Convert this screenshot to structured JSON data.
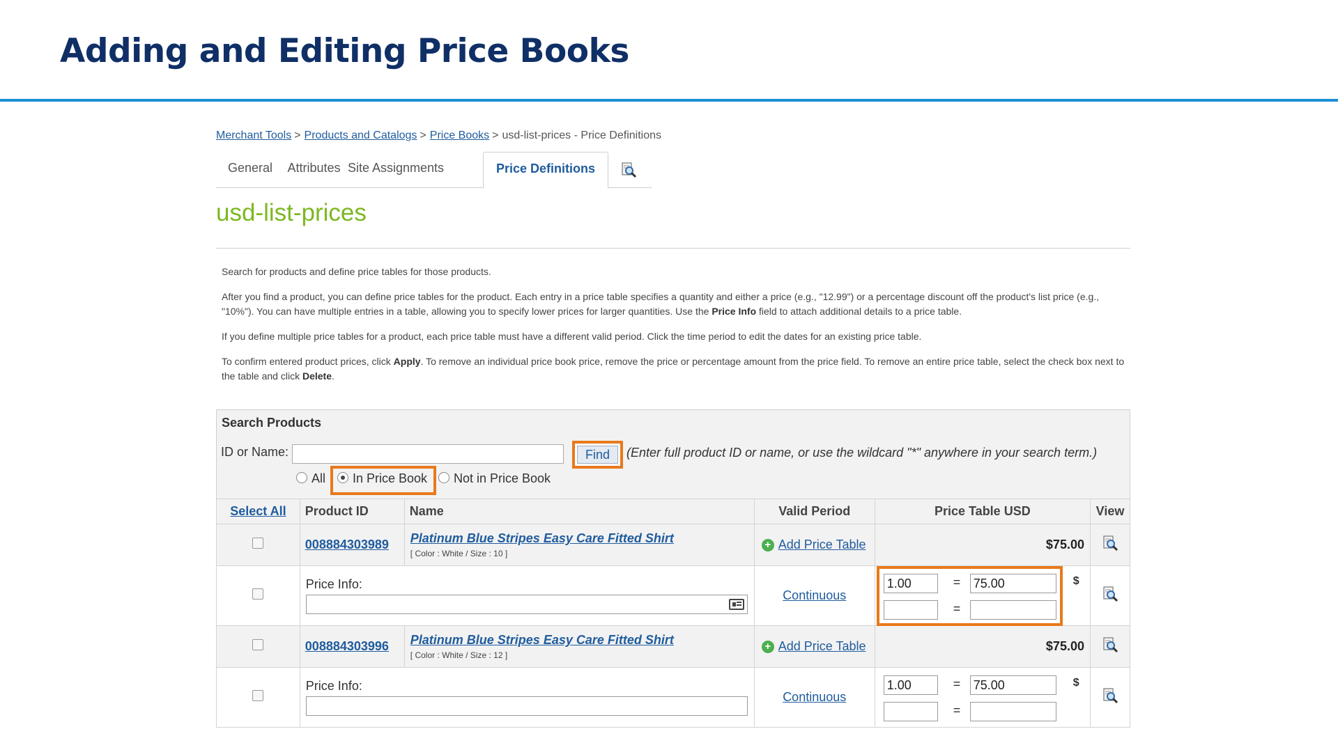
{
  "slide": {
    "title": "Adding and Editing Price Books"
  },
  "breadcrumb": {
    "items": [
      "Merchant Tools",
      "Products and Catalogs",
      "Price Books"
    ],
    "separator": ">",
    "current": "usd-list-prices - Price Definitions"
  },
  "tabs": [
    {
      "label": "General"
    },
    {
      "label": "Attributes"
    },
    {
      "label": "Site Assignments"
    },
    {
      "label": "Price Definitions",
      "active": true
    }
  ],
  "tab_extra_icon": "view-icon",
  "pricebook": {
    "name": "usd-list-prices"
  },
  "description": {
    "p1": "Search for products and define price tables for those products.",
    "p2a": "After you find a product, you can define price tables for the product. Each entry in a price table specifies a quantity and either a price (e.g., \"12.99\") or a percentage discount off the product's list price (e.g., \"10%\"). You can have multiple entries in a table, allowing you to specify lower prices for larger quantities. Use the ",
    "p2b": "Price Info",
    "p2c": " field to attach additional details to a price table.",
    "p3": "If you define multiple price tables for a product, each price table must have a different valid period. Click the time period to edit the dates for an existing price table.",
    "p4a": "To confirm entered product prices, click ",
    "p4b": "Apply",
    "p4c": ". To remove an individual price book price, remove the price or percentage amount from the price field. To remove an entire price table, select the check box next to the table and click ",
    "p4d": "Delete",
    "p4e": "."
  },
  "search": {
    "title": "Search Products",
    "id_label": "ID or Name:",
    "id_value": "",
    "find_label": "Find",
    "hint": "(Enter full product ID or name, or use the wildcard \"*\" anywhere in your search term.)",
    "filters": [
      {
        "label": "All",
        "selected": false
      },
      {
        "label": "In Price Book",
        "selected": true
      },
      {
        "label": "Not in Price Book",
        "selected": false
      }
    ]
  },
  "table": {
    "headers": {
      "select_all": "Select All",
      "product_id": "Product ID",
      "name": "Name",
      "valid_period": "Valid Period",
      "price_table": "Price Table USD",
      "view": "View"
    },
    "products": [
      {
        "id": "008884303989",
        "name": "Platinum Blue Stripes Easy Care Fitted Shirt",
        "attrs": "[ Color :  White / Size :  10 ]",
        "add_price_table": "Add Price Table",
        "price": "$75.00",
        "price_info_label": "Price Info:",
        "price_info_value": "",
        "valid_period": "Continuous",
        "entries": [
          {
            "quantity": "1.00",
            "price": "75.00"
          },
          {
            "quantity": "",
            "price": ""
          }
        ],
        "currency": "$"
      },
      {
        "id": "008884303996",
        "name": "Platinum Blue Stripes Easy Care Fitted Shirt",
        "attrs": "[ Color :  White / Size :  12 ]",
        "add_price_table": "Add Price Table",
        "price": "$75.00",
        "price_info_label": "Price Info:",
        "price_info_value": "",
        "valid_period": "Continuous",
        "entries": [
          {
            "quantity": "1.00",
            "price": "75.00"
          },
          {
            "quantity": "",
            "price": ""
          }
        ],
        "currency": "$"
      }
    ],
    "equals": "="
  },
  "colors": {
    "title": "#0f2f66",
    "rule": "#1b8fd6",
    "link": "#1f5c9e",
    "pricebook_name": "#7cb821",
    "highlight": "#e8791b"
  }
}
